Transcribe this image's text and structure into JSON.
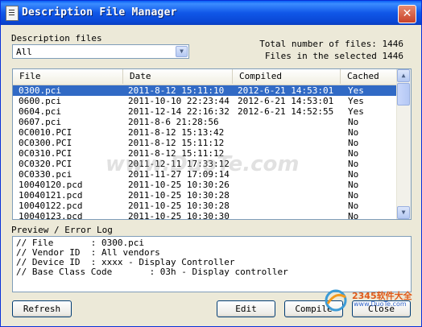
{
  "window": {
    "title": "Description File Manager",
    "close_glyph": "✕"
  },
  "filter": {
    "label": "Description files",
    "selected": "All"
  },
  "stats": {
    "total": "Total number of files: 1446",
    "selected": "Files in the selected 1446"
  },
  "table": {
    "columns": [
      "File",
      "Date",
      "Compiled",
      "Cached"
    ],
    "rows": [
      {
        "file": "0300.pci",
        "date": "2011-8-12 15:11:10",
        "compiled": "2012-6-21 14:53:01",
        "cached": "Yes",
        "selected": true
      },
      {
        "file": "0600.pci",
        "date": "2011-10-10 22:23:44",
        "compiled": "2012-6-21 14:53:01",
        "cached": "Yes"
      },
      {
        "file": "0604.pci",
        "date": "2011-12-14 22:16:32",
        "compiled": "2012-6-21 14:52:55",
        "cached": "Yes"
      },
      {
        "file": "0607.pci",
        "date": "2011-8-6 21:28:56",
        "compiled": "",
        "cached": "No"
      },
      {
        "file": "0C0010.PCI",
        "date": "2011-8-12 15:13:42",
        "compiled": "",
        "cached": "No"
      },
      {
        "file": "0C0300.PCI",
        "date": "2011-8-12 15:11:12",
        "compiled": "",
        "cached": "No"
      },
      {
        "file": "0C0310.PCI",
        "date": "2011-8-12 15:11:12",
        "compiled": "",
        "cached": "No"
      },
      {
        "file": "0C0320.PCI",
        "date": "2011-12-11 17:33:12",
        "compiled": "",
        "cached": "No"
      },
      {
        "file": "0C0330.pci",
        "date": "2011-11-27 17:09:14",
        "compiled": "",
        "cached": "No"
      },
      {
        "file": "10040120.pcd",
        "date": "2011-10-25 10:30:26",
        "compiled": "",
        "cached": "No"
      },
      {
        "file": "10040121.pcd",
        "date": "2011-10-25 10:30:28",
        "compiled": "",
        "cached": "No"
      },
      {
        "file": "10040122.pcd",
        "date": "2011-10-25 10:30:28",
        "compiled": "",
        "cached": "No"
      },
      {
        "file": "10040123.pcd",
        "date": "2011-10-25 10:30:30",
        "compiled": "",
        "cached": "No"
      }
    ]
  },
  "log": {
    "label": "Preview / Error Log",
    "lines": [
      "// File       : 0300.pci",
      "// Vendor ID  : All vendors",
      "// Device ID  : xxxx - Display Controller",
      "// Base Class Code       : 03h - Display controller"
    ]
  },
  "buttons": {
    "refresh": "Refresh",
    "edit": "Edit",
    "compile": "Compile",
    "close": "Close"
  },
  "watermark": "www.DuoTe.com",
  "logo": {
    "text": "2345软件大全",
    "url": "www.DuoTe.com"
  }
}
